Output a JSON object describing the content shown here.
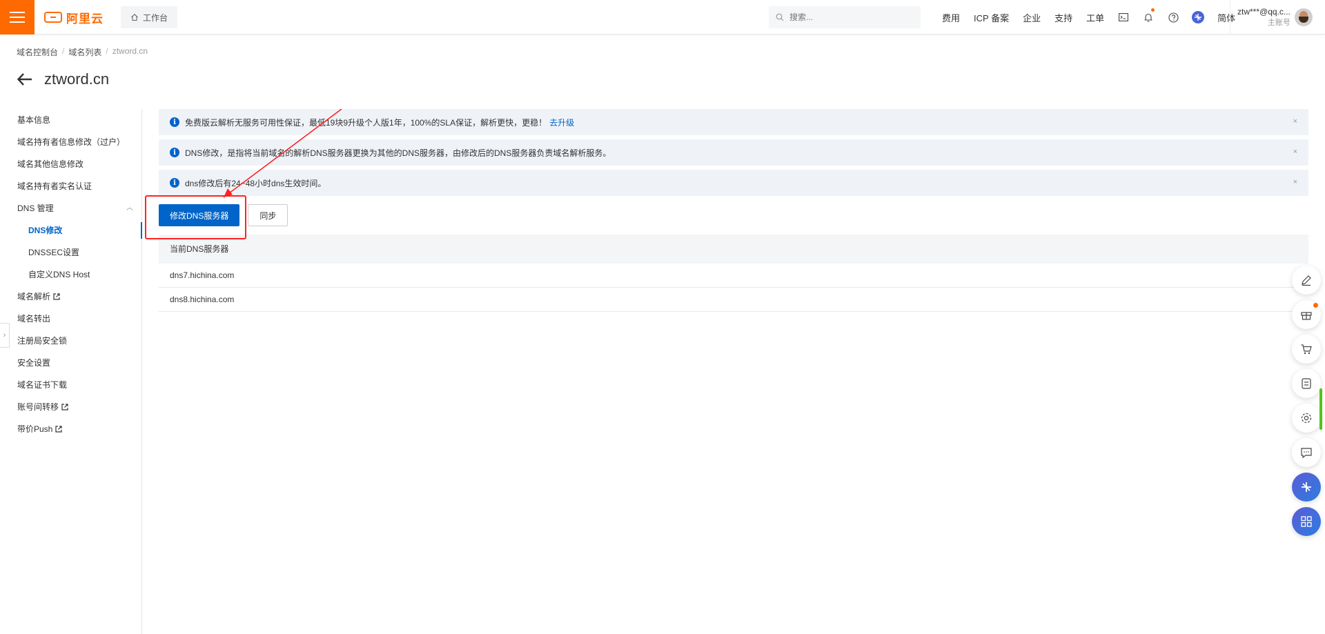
{
  "topbar": {
    "logo_text": "阿里云",
    "workbench_label": "工作台",
    "search_placeholder": "搜索...",
    "nav_items": [
      "费用",
      "ICP 备案",
      "企业",
      "支持",
      "工单"
    ],
    "language": "简体",
    "account_email": "ztw***@qq.c...",
    "account_role": "主账号",
    "accent_color": "#ff6a00"
  },
  "breadcrumb": [
    "域名控制台",
    "域名列表",
    "ztword.cn"
  ],
  "page_title": "ztword.cn",
  "sidebar": {
    "items": [
      {
        "label": "基本信息"
      },
      {
        "label": "域名持有者信息修改（过户）"
      },
      {
        "label": "域名其他信息修改"
      },
      {
        "label": "域名持有者实名认证"
      },
      {
        "label": "DNS 管理"
      },
      {
        "label": "DNS修改"
      },
      {
        "label": "DNSSEC设置"
      },
      {
        "label": "自定义DNS Host"
      },
      {
        "label": "域名解析"
      },
      {
        "label": "域名转出"
      },
      {
        "label": "注册局安全锁"
      },
      {
        "label": "安全设置"
      },
      {
        "label": "域名证书下载"
      },
      {
        "label": "账号间转移"
      },
      {
        "label": "带价Push"
      }
    ]
  },
  "alerts": [
    {
      "text": "免费版云解析无服务可用性保证，最低19块9升级个人版1年，100%的SLA保证，解析更快，更稳！",
      "link": "去升级"
    },
    {
      "text": "DNS修改，是指将当前域名的解析DNS服务器更换为其他的DNS服务器，由修改后的DNS服务器负责域名解析服务。"
    },
    {
      "text": "dns修改后有24~48小时dns生效时间。"
    }
  ],
  "buttons": {
    "modify_dns": "修改DNS服务器",
    "sync": "同步"
  },
  "dns_table": {
    "header": "当前DNS服务器",
    "rows": [
      "dns7.hichina.com",
      "dns8.hichina.com"
    ]
  },
  "primary_color": "#0064c8"
}
